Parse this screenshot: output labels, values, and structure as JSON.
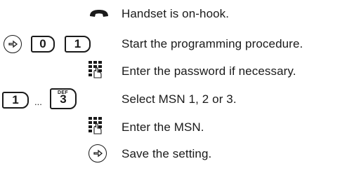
{
  "steps": [
    {
      "icons": [
        "handset-icon"
      ],
      "text": "Handset is on-hook."
    },
    {
      "icons": [
        "function-key-icon",
        "key-0",
        "key-1"
      ],
      "keys": [
        "0",
        "1"
      ],
      "text": "Start the programming procedure."
    },
    {
      "icons": [
        "keypad-hand-icon"
      ],
      "text": "Enter the password if necessary."
    },
    {
      "icons": [
        "key-1",
        "key-3"
      ],
      "keys": [
        "1",
        "3"
      ],
      "key3_letters": "DEF",
      "ellipsis": "...",
      "text": "Select MSN 1, 2 or 3."
    },
    {
      "icons": [
        "keypad-hand-icon"
      ],
      "text": "Enter the MSN."
    },
    {
      "icons": [
        "function-key-icon"
      ],
      "text": "Save the setting."
    }
  ]
}
